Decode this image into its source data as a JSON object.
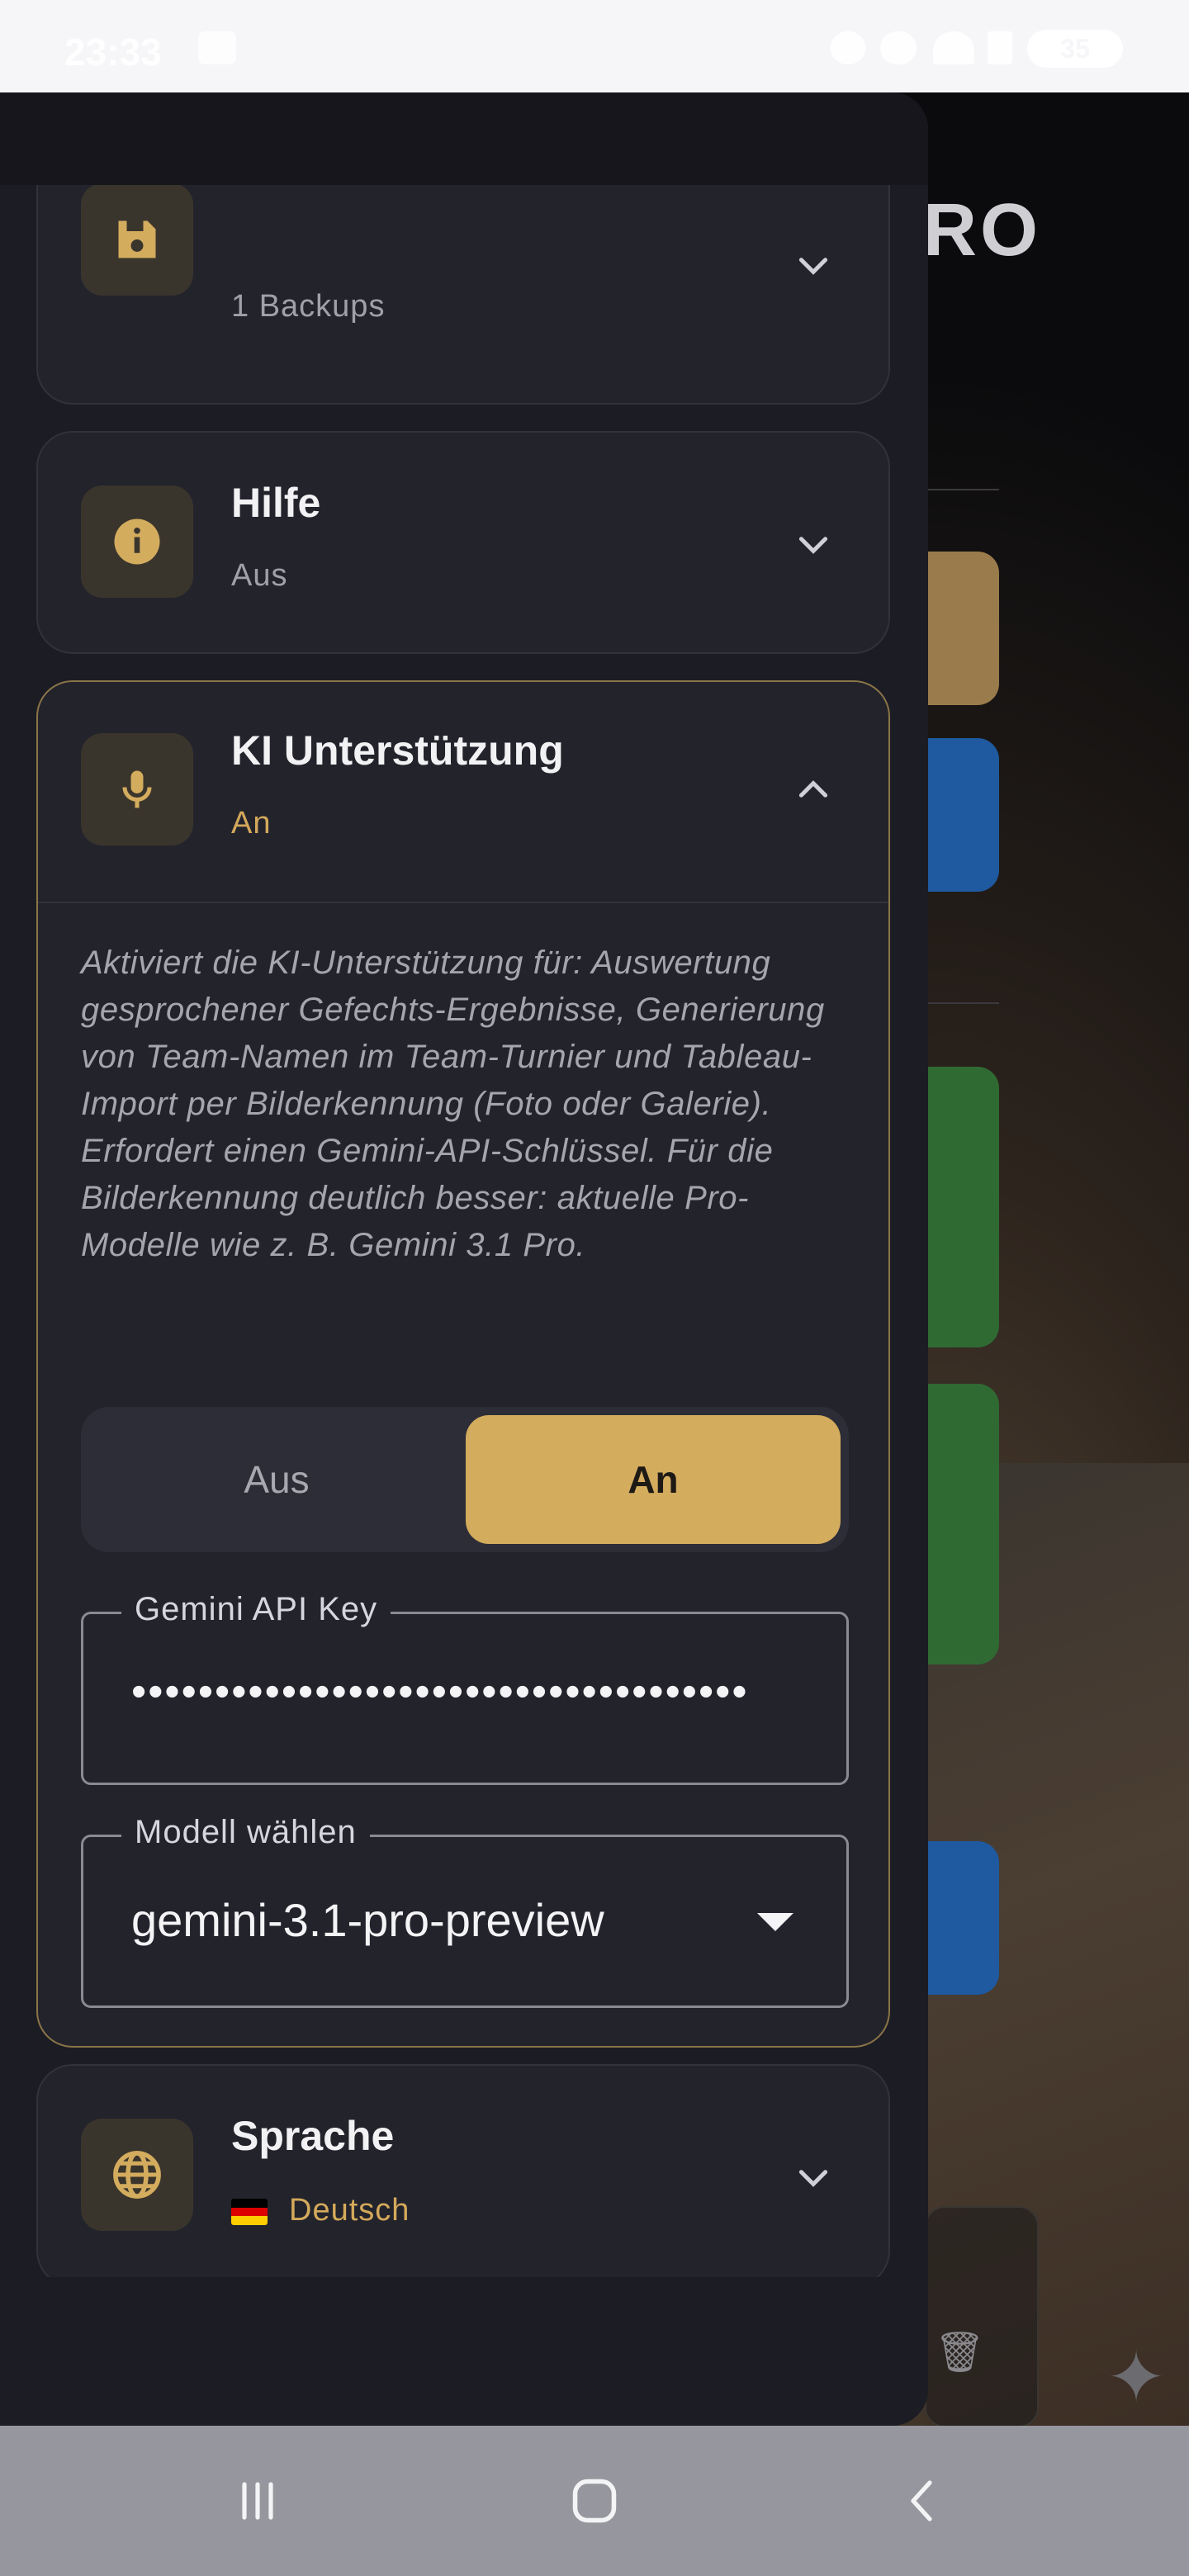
{
  "status_bar": {
    "time": "23:33",
    "battery": "35"
  },
  "background_app": {
    "title_fragment": "RO",
    "colors": {
      "gold": "#9a7b4c",
      "blue": "#1f5aa0",
      "green": "#2f6a33"
    }
  },
  "flag_colors": [
    "#000000",
    "#dd0000",
    "#ffce00"
  ],
  "settings": {
    "backup": {
      "title": "",
      "subtitle": "1 Backups",
      "icon": "save-icon"
    },
    "help": {
      "title": "Hilfe",
      "subtitle": "Aus",
      "icon": "info-icon"
    },
    "ai": {
      "title": "KI Unterstützung",
      "subtitle": "An",
      "icon": "mic-icon",
      "description": "Aktiviert die KI-Unterstützung für: Auswertung gesprochener Gefechts-Ergebnisse, Generierung von Team-Namen im Team-Turnier und Tableau-Import per Bilderkennung (Foto oder Galerie). Erfordert einen Gemini-API-Schlüssel. Für die Bilderkennung deutlich besser: aktuelle Pro-Modelle wie z. B. Gemini 3.1 Pro.",
      "toggle": {
        "off_label": "Aus",
        "on_label": "An",
        "selected": "An"
      },
      "api_key": {
        "label": "Gemini API Key",
        "value": "•••••••••••••••••••••••••••••••••••••"
      },
      "model": {
        "label": "Modell wählen",
        "value": "gemini-3.1-pro-preview"
      }
    },
    "language": {
      "title": "Sprache",
      "subtitle": "Deutsch",
      "icon": "globe-icon"
    }
  },
  "accent_color": "#d4ac5e"
}
